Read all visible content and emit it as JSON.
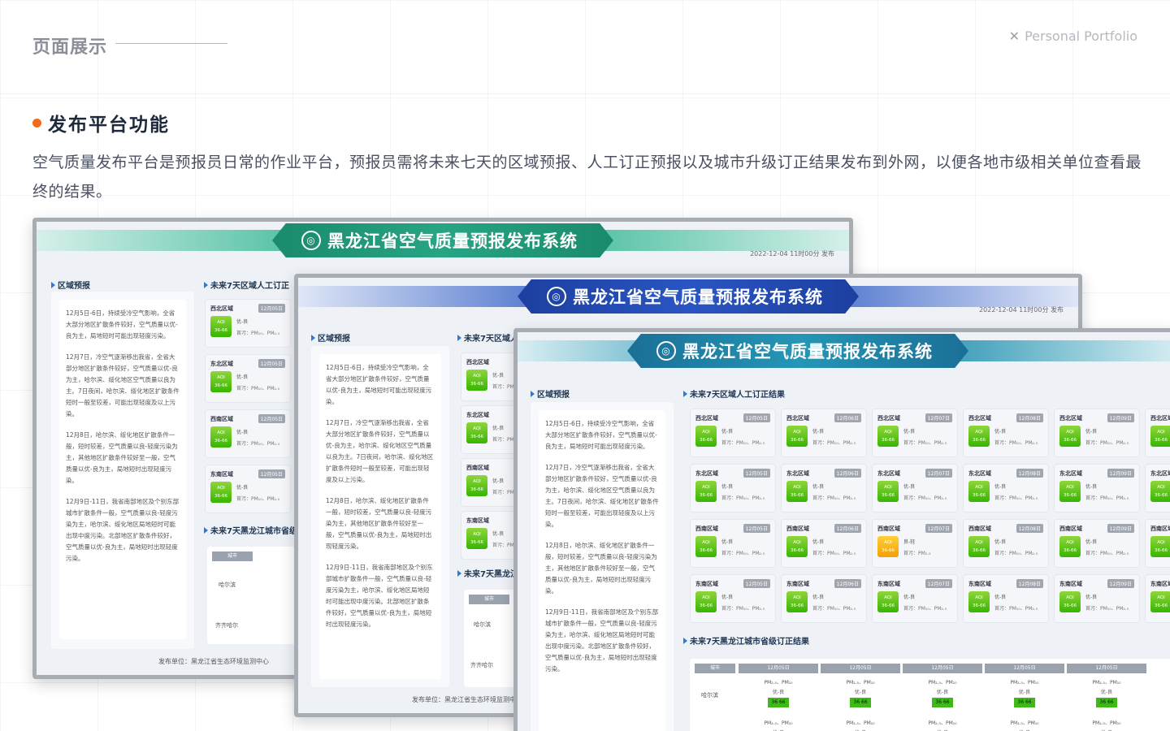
{
  "header": {
    "title": "页面展示",
    "portfolio": "Personal Portfolio"
  },
  "section": {
    "title": "发布平台功能",
    "description": "空气质量发布平台是预报员日常的作业平台，预报员需将未来七天的区域预报、人工订正预报以及城市升级订正结果发布到外网，以便各地市级相关单位查看最终的结果。"
  },
  "app": {
    "title": "黑龙江省空气质量预报发布系统",
    "date": "2022-12-04 11时00分 发布",
    "tab_region": "区域预报",
    "tab_manual": "未来7天区域人工订正结果",
    "tab_manual_short": "未来7天区域人工订正",
    "tab_manual_cut": "未来7天区域人",
    "tab_city": "未来7天黑龙江城市省级订正结果",
    "tab_city_short": "未来7天黑龙江城市省级",
    "tab_city_cut": "未来7天黑龙江",
    "publisher": "发布单位：黑龙江省生态环境监测中心",
    "paragraphs": [
      "12月5日-6日，持续受冷空气影响，全省大部分地区扩散条件较好，空气质量以优-良为主，局地短时可能出现轻度污染。",
      "12月7日，冷空气逐渐移出我省，全省大部分地区扩散条件较好，空气质量以优-良为主，哈尔滨、绥化地区空气质量以良为主。7日夜间，哈尔滨、绥化地区扩散条件短时一般至较差，可能出现轻度及以上污染。",
      "12月8日，哈尔滨、绥化地区扩散条件一般，短时较差，空气质量以良-轻度污染为主，其他地区扩散条件较好至一般，空气质量以优-良为主，局地短时出现轻度污染。",
      "12月9日-11日，我省南部地区及个别东部城市扩散条件一般，空气质量以良-轻度污染为主，哈尔滨、绥化地区局地短时可能出现中度污染。北部地区扩散条件较好，空气质量以优-良为主，局地短时出现轻度污染。"
    ],
    "regions": [
      "西北区域",
      "东北区域",
      "西南区域",
      "东南区域"
    ],
    "dates": [
      "12月05日",
      "12月06日",
      "12月07日",
      "12月08日",
      "12月09日"
    ],
    "aqi_label": "AQI",
    "aqi_range": "36-66",
    "level": "优-良",
    "level_alt": "良-轻",
    "pollutant": "首污：PM₁₀、PM₂.₅",
    "pollutant_alt": "首污：PM₂.₅",
    "city_header": "城市",
    "cities": [
      "哈尔滨",
      "齐齐哈尔"
    ],
    "city_pm": "PM₂.₅、PM₁₀",
    "city_aqi": "36 66"
  }
}
